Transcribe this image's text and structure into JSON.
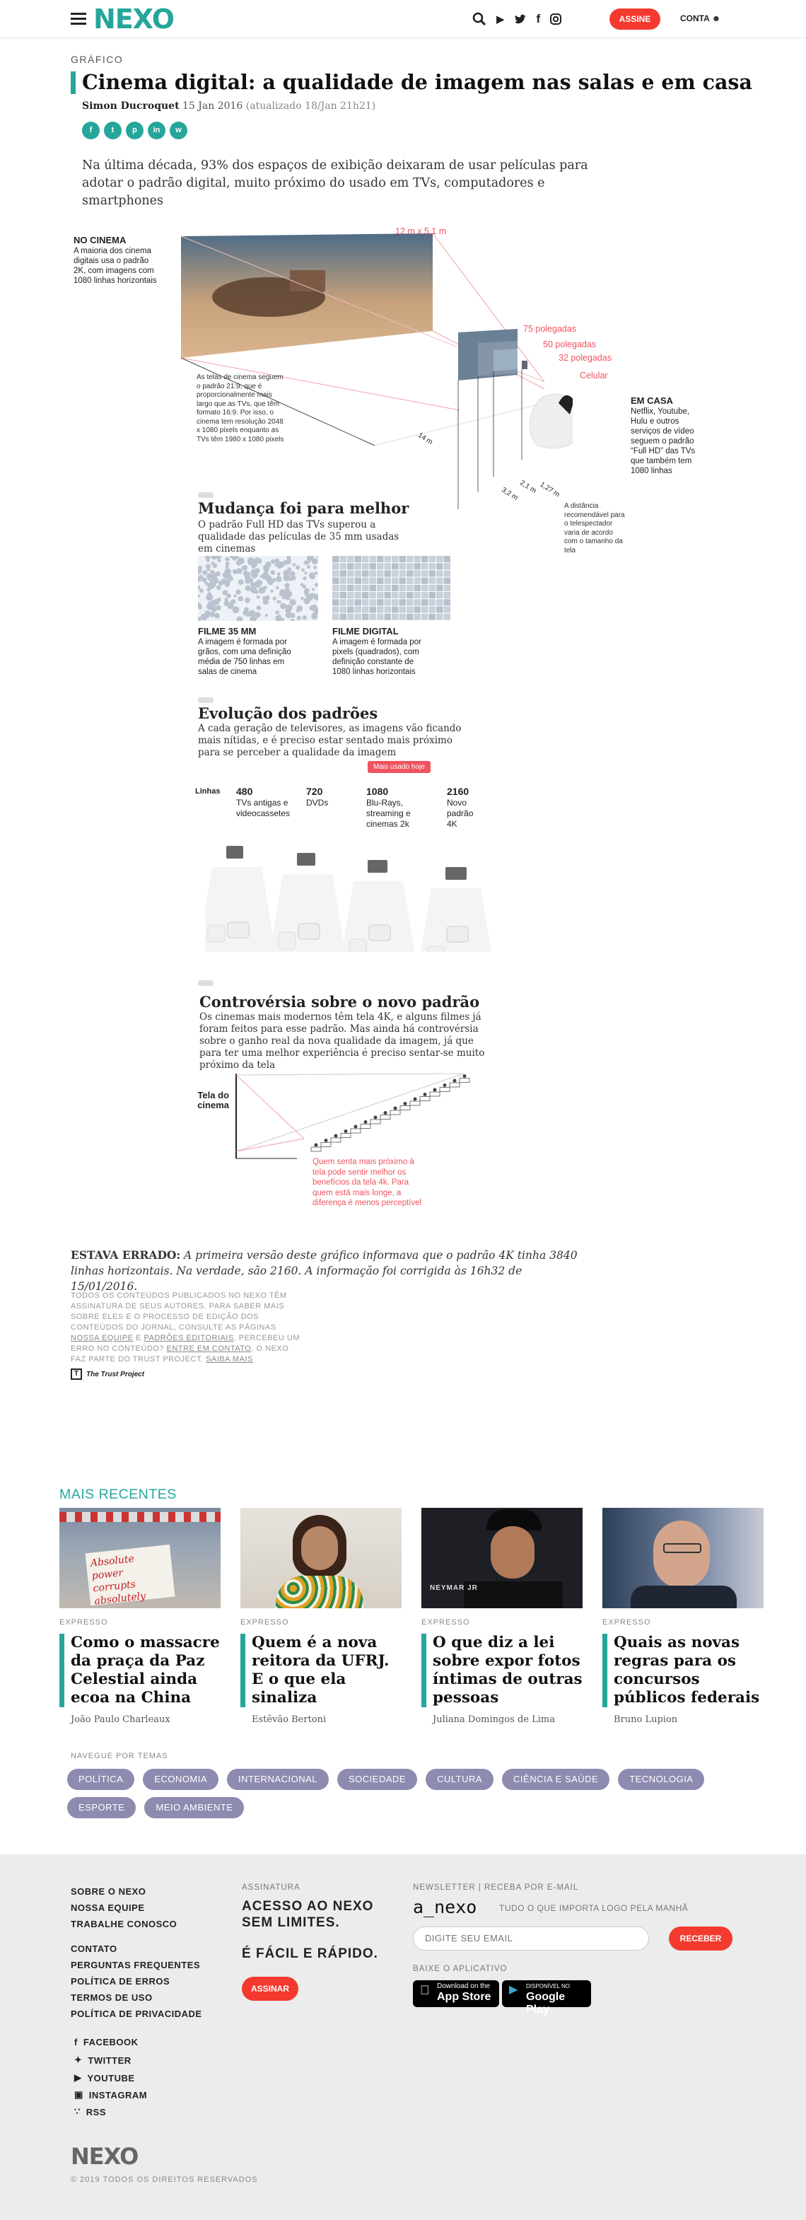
{
  "header": {
    "logo": "NEXO",
    "subscribe": "ASSINE",
    "account": "CONTA"
  },
  "article": {
    "kicker": "GRÁFICO",
    "title": "Cinema digital: a qualidade de imagem nas salas e em casa",
    "author": "Simon Ducroquet",
    "date": "15 Jan 2016",
    "updated": "(atualizado 18/Jan 21h21)",
    "lede": "Na última década, 93% dos espaços de exibição deixaram de usar películas para adotar o padrão digital, muito próximo do usado em TVs, computadores e smartphones"
  },
  "graphic": {
    "cinema_head": "NO CINEMA",
    "cinema_text": [
      "A maioria dos cinema",
      "digitais usa o padrão",
      "2K, com imagens com",
      "1080 linhas horizontais"
    ],
    "screen_size": "12 m x 5,1 m",
    "sizes": [
      "75 polegadas",
      "50 polegadas",
      "32 polegadas",
      "Celular"
    ],
    "cinema_note": [
      "As telas de cinema seguem",
      "o padrão 21:9, que é",
      "proporcionalmente mais",
      "largo que as TVs, que têm",
      "formato 16:9. Por isso, o",
      "cinema tem resolução 2048",
      "x 1080 pixels enquanto as",
      "TVs têm 1980 x 1080 pixels"
    ],
    "home_head": "EM CASA",
    "home_text": [
      "Netflix, Youtube,",
      "Hulu e outros",
      "serviços de vídeo",
      "seguem o padrão",
      "“Full HD” das TVs",
      "que também tem",
      "1080 linhas"
    ],
    "distances": [
      "14 m",
      "3,2 m",
      "2,1 m",
      "1,27 m"
    ],
    "distance_note": [
      "A distância",
      "recomendável para",
      "o telespectador",
      "varia de acordo",
      "com o tamanho da",
      "tela"
    ],
    "s1_title": "Mudança foi para melhor",
    "s1_text": [
      "O padrão Full HD das TVs superou a",
      "qualidade das películas de 35 mm usadas",
      "em cinemas"
    ],
    "film_head": "FILME 35 MM",
    "film_text": [
      "A imagem é formada por",
      "grãos, com uma definição",
      "média de 750 linhas em",
      "salas de cinema"
    ],
    "digital_head": "FILME DIGITAL",
    "digital_text": [
      "A imagem é formada por",
      "pixels (quadrados), com",
      "definição constante de",
      "1080 linhas horizontais"
    ],
    "s2_title": "Evolução dos padrões",
    "s2_text": [
      "A cada geração de televisores, as imagens vão ficando",
      "mais nítidas, e é preciso estar sentado mais próximo",
      "para se perceber a qualidade da imagem"
    ],
    "most_used": "Mais usado hoje",
    "lines_label": "Linhas",
    "steps": [
      {
        "n": "480",
        "d": [
          "TVs antigas e",
          "videocassetes"
        ]
      },
      {
        "n": "720",
        "d": [
          "DVDs"
        ]
      },
      {
        "n": "1080",
        "d": [
          "Blu-Rays,",
          "streaming e",
          "cinemas 2k"
        ]
      },
      {
        "n": "2160",
        "d": [
          "Novo",
          "padrão",
          "4K"
        ]
      }
    ],
    "s3_title": "Controvérsia sobre o novo padrão",
    "s3_text": [
      "Os cinemas mais modernos têm tela 4K, e alguns filmes já",
      "foram feitos para esse padrão. Mas ainda há controvérsia",
      "sobre o ganho real da nova qualidade da imagem, já que",
      "para ter uma melhor experiência é preciso sentar-se muito",
      "próximo da tela"
    ],
    "screen_label": [
      "Tela do",
      "cinema"
    ],
    "seat_note": [
      "Quem senta mais próximo à",
      "tela pode sentir melhor os",
      "benefícios da tela 4k. Para",
      "quem está mais longe, a",
      "diferença é menos perceptível"
    ]
  },
  "errata": {
    "lead": "ESTAVA ERRADO:",
    "text": "A primeira versão deste gráfico informava que o padrão 4K tinha 3840 linhas horizontais. Na verdade, são 2160. A informação foi corrigida às 16h32 de 15/01/2016."
  },
  "trust": {
    "text1": "TODOS OS CONTEÚDOS PUBLICADOS NO NEXO TÊM ASSINATURA DE SEUS AUTORES. PARA SABER MAIS SOBRE ELES E O PROCESSO DE EDIÇÃO DOS CONTEÚDOS DO JORNAL, CONSULTE AS PÁGINAS",
    "link1": "NOSSA EQUIPE",
    "and": "E",
    "link2": "PADRÕES EDITORIAIS",
    "text2": ". PERCEBEU UM ERRO NO CONTEÚDO?",
    "link3": "ENTRE EM CONTATO",
    "text3": ". O NEXO FAZ PARTE DO TRUST PROJECT.",
    "link4": "SAIBA MAIS",
    "logo": "The Trust Project"
  },
  "recent": {
    "title": "MAIS RECENTES",
    "cards": [
      {
        "section": "EXPRESSO",
        "headline": "Como o massacre da praça da Paz Celestial ainda ecoa na China",
        "author": "João Paulo Charleaux",
        "sign1": "Absolute power",
        "sign2": "corrupts",
        "sign3": "absolutely"
      },
      {
        "section": "EXPRESSO",
        "headline": "Quem é a nova reitora da UFRJ. E o que ela sinaliza",
        "author": "Estêvão Bertoni"
      },
      {
        "section": "EXPRESSO",
        "headline": "O que diz a lei sobre expor fotos íntimas de outras pessoas",
        "author": "Juliana Domingos de Lima",
        "shirt": "NEYMAR JR"
      },
      {
        "section": "EXPRESSO",
        "headline": "Quais as novas regras para os concursos públicos federais",
        "author": "Bruno Lupion"
      }
    ]
  },
  "topics": {
    "title": "NAVEGUE POR TEMAS",
    "items": [
      "POLÍTICA",
      "ECONOMIA",
      "INTERNACIONAL",
      "SOCIEDADE",
      "CULTURA",
      "CIÊNCIA E SAÚDE",
      "TECNOLOGIA",
      "ESPORTE",
      "MEIO AMBIENTE"
    ]
  },
  "footer": {
    "col1a": [
      "SOBRE O NEXO",
      "NOSSA EQUIPE",
      "TRABALHE CONOSCO"
    ],
    "col1b": [
      "CONTATO",
      "PERGUNTAS FREQUENTES",
      "POLÍTICA DE ERROS",
      "TERMOS DE USO",
      "POLÍTICA DE PRIVACIDADE"
    ],
    "social": [
      "FACEBOOK",
      "TWITTER",
      "YOUTUBE",
      "INSTAGRAM",
      "RSS"
    ],
    "assn_head": "ASSINATURA",
    "assn_l1": "ACESSO AO NEXO",
    "assn_l2": "SEM LIMITES.",
    "assn_l3": "É FÁCIL E RÁPIDO.",
    "assn_btn": "ASSINAR",
    "news_head": "NEWSLETTER | RECEBA POR E-MAIL",
    "anexo": "a_nexo",
    "anexo_tag": "TUDO O QUE IMPORTA LOGO PELA MANHÃ",
    "email_placeholder": "DIGITE SEU EMAIL",
    "receive": "RECEBER",
    "app_head": "BAIXE O APLICATIVO",
    "appstore_small": "Download on the",
    "appstore_big": "App Store",
    "gplay_small": "DISPONÍVEL NO",
    "gplay_big": "Google Play",
    "logo": "NEXO",
    "copyright": "© 2019 TODOS OS DIREITOS RESERVADOS"
  },
  "colors": {
    "accent": "#26a69a",
    "red": "#f43a2e",
    "pink": "#f0535f",
    "tag": "#8e8bb0"
  }
}
